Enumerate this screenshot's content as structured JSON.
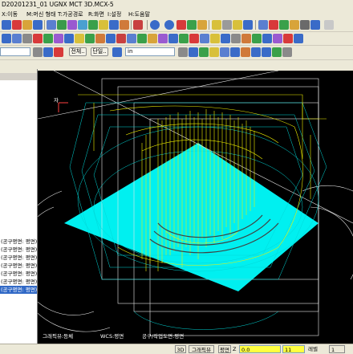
{
  "window": {
    "title": "D20201231_01 UGNX MCT 3D.MCX-5"
  },
  "menu": {
    "items": [
      "X:이동",
      "M:머신 형태",
      "T:가공경로",
      "R:화면",
      "I:설정",
      "H:도움말"
    ]
  },
  "toolbar3": {
    "dropdown_left": "",
    "btn_all": "전체..",
    "btn_single": "단일..",
    "unit_value": "in"
  },
  "tree": {
    "items": [
      "(공구평면: 평면)",
      "(공구평면: 평면)",
      "(공구평면: 평면)",
      "(공구평면: 평면)",
      "(공구평면: 평면)",
      "(공구평면: 평면)",
      "(공구평면: 평면)"
    ],
    "selected_index": 6
  },
  "viewport": {
    "axis_label": "자",
    "status_graphics": "그래픽뷰:등체",
    "status_wcs": "WCS:평면",
    "status_tool": "공구/작업도면:평면",
    "bg_color": "#000000",
    "stock_color": "#00f0f0",
    "toolpath_color": "#f0f000"
  },
  "statusbar": {
    "mode": "3D",
    "graphics_view": "그래픽뷰",
    "plane": "평면",
    "z_label": "Z",
    "z_value": "0.0",
    "level_value": "11",
    "level_label": "레벨",
    "last_value": "1"
  }
}
